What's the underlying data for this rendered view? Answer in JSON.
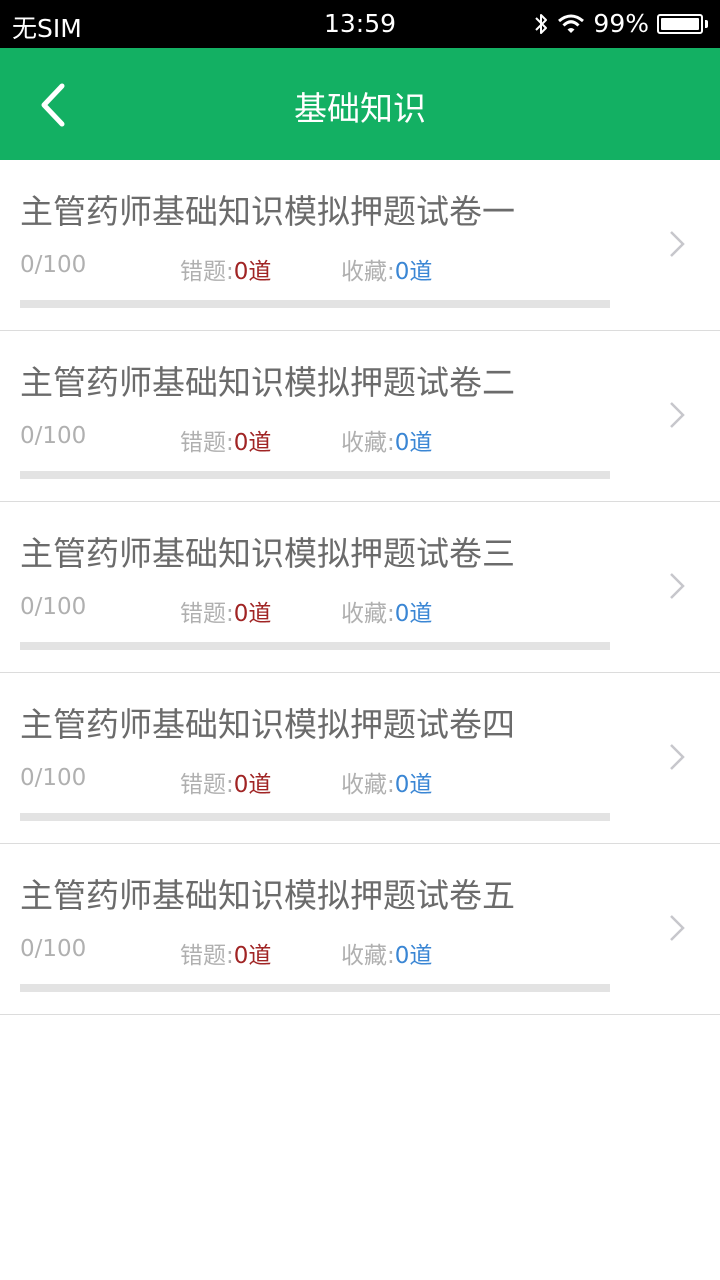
{
  "status_bar": {
    "carrier": "无SIM",
    "time": "13:59",
    "battery_text": "99%",
    "battery_level": 0.99
  },
  "nav": {
    "title": "基础知识",
    "back_icon": "chevron-left-icon",
    "color": "#13b063"
  },
  "list": {
    "items": [
      {
        "title": "主管药师基础知识模拟押题试卷一",
        "progress": "0/100",
        "progress_fraction": 0,
        "wrong_label": "错题:",
        "wrong_value": "0道",
        "fav_label": "收藏:",
        "fav_value": "0道"
      },
      {
        "title": "主管药师基础知识模拟押题试卷二",
        "progress": "0/100",
        "progress_fraction": 0,
        "wrong_label": "错题:",
        "wrong_value": "0道",
        "fav_label": "收藏:",
        "fav_value": "0道"
      },
      {
        "title": "主管药师基础知识模拟押题试卷三",
        "progress": "0/100",
        "progress_fraction": 0,
        "wrong_label": "错题:",
        "wrong_value": "0道",
        "fav_label": "收藏:",
        "fav_value": "0道"
      },
      {
        "title": "主管药师基础知识模拟押题试卷四",
        "progress": "0/100",
        "progress_fraction": 0,
        "wrong_label": "错题:",
        "wrong_value": "0道",
        "fav_label": "收藏:",
        "fav_value": "0道"
      },
      {
        "title": "主管药师基础知识模拟押题试卷五",
        "progress": "0/100",
        "progress_fraction": 0,
        "wrong_label": "错题:",
        "wrong_value": "0道",
        "fav_label": "收藏:",
        "fav_value": "0道"
      }
    ]
  },
  "colors": {
    "wrong_value": "#a02424",
    "fav_value": "#3a86d4",
    "muted_text": "#b0b0b0"
  }
}
